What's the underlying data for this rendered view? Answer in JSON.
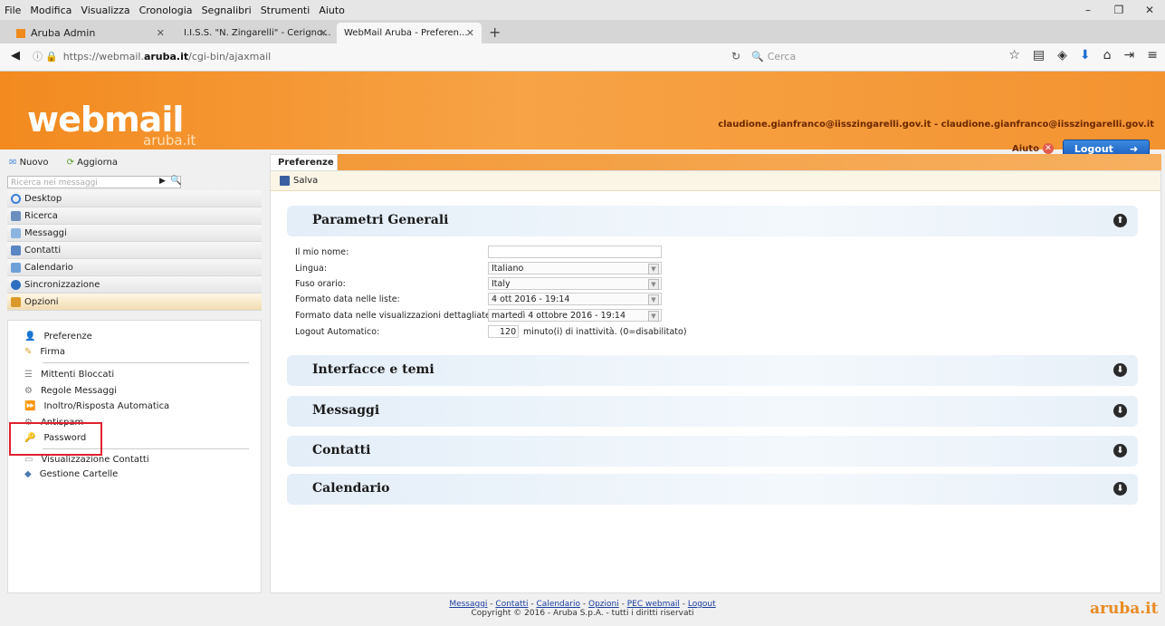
{
  "browser": {
    "menu": [
      "File",
      "Modifica",
      "Visualizza",
      "Cronologia",
      "Segnalibri",
      "Strumenti",
      "Aiuto"
    ],
    "tabs": [
      {
        "title": "Aruba Admin"
      },
      {
        "title": "I.I.S.S. \"N. Zingarelli\" - Cerigno..."
      },
      {
        "title": "WebMail Aruba - Preferen..."
      }
    ],
    "url_prefix": "https://webmail.",
    "url_domain": "aruba.it",
    "url_path": "/cgi-bin/ajaxmail",
    "search_placeholder": "Cerca"
  },
  "header": {
    "logo_main": "webmail",
    "logo_sub": "aruba.it",
    "email": "claudione.gianfranco@iisszingarelli.gov.it - claudione.gianfranco@iisszingarelli.gov.it",
    "help": "Aiuto",
    "logout": "Logout"
  },
  "sidebar": {
    "new": "Nuovo",
    "refresh": "Aggiorna",
    "search_placeholder": "Ricerca nei messaggi",
    "nav": [
      {
        "label": "Desktop",
        "color": "#3b7dd8"
      },
      {
        "label": "Ricerca",
        "color": "#6a8fbf"
      },
      {
        "label": "Messaggi",
        "color": "#8cb4e0"
      },
      {
        "label": "Contatti",
        "color": "#5a86c4"
      },
      {
        "label": "Calendario",
        "color": "#6fa0d8"
      },
      {
        "label": "Sincronizzazione",
        "color": "#2f6fc0"
      },
      {
        "label": "Opzioni",
        "color": "#d99a2b"
      }
    ],
    "options": [
      "Preferenze",
      "Firma",
      "Mittenti Bloccati",
      "Regole Messaggi",
      "Inoltro/Risposta Automatica",
      "Antispam",
      "Password",
      "Visualizzazione Contatti",
      "Gestione Cartelle"
    ]
  },
  "main": {
    "tab": "Preferenze",
    "save": "Salva",
    "sections": [
      "Parametri Generali",
      "Interfacce e temi",
      "Messaggi",
      "Contatti",
      "Calendario"
    ],
    "form": {
      "name_label": "Il mio nome:",
      "lang_label": "Lingua:",
      "lang_value": "Italiano",
      "tz_label": "Fuso orario:",
      "tz_value": "Italy",
      "datelist_label": "Formato data nelle liste:",
      "datelist_value": "4 ott 2016 - 19:14",
      "datedetail_label": "Formato data nelle visualizzazioni dettagliate:",
      "datedetail_value": "martedì 4 ottobre 2016 - 19:14",
      "logout_label": "Logout Automatico:",
      "logout_value": "120",
      "logout_unit": "minuto(i) di inattività. (0=disabilitato)"
    }
  },
  "footer": {
    "links": [
      "Messaggi",
      "Contatti",
      "Calendario",
      "Opzioni",
      "PEC webmail",
      "Logout"
    ],
    "copyright": "Copyright © 2016 - Aruba S.p.A. - tutti i diritti riservati",
    "logo": "aruba.it"
  }
}
